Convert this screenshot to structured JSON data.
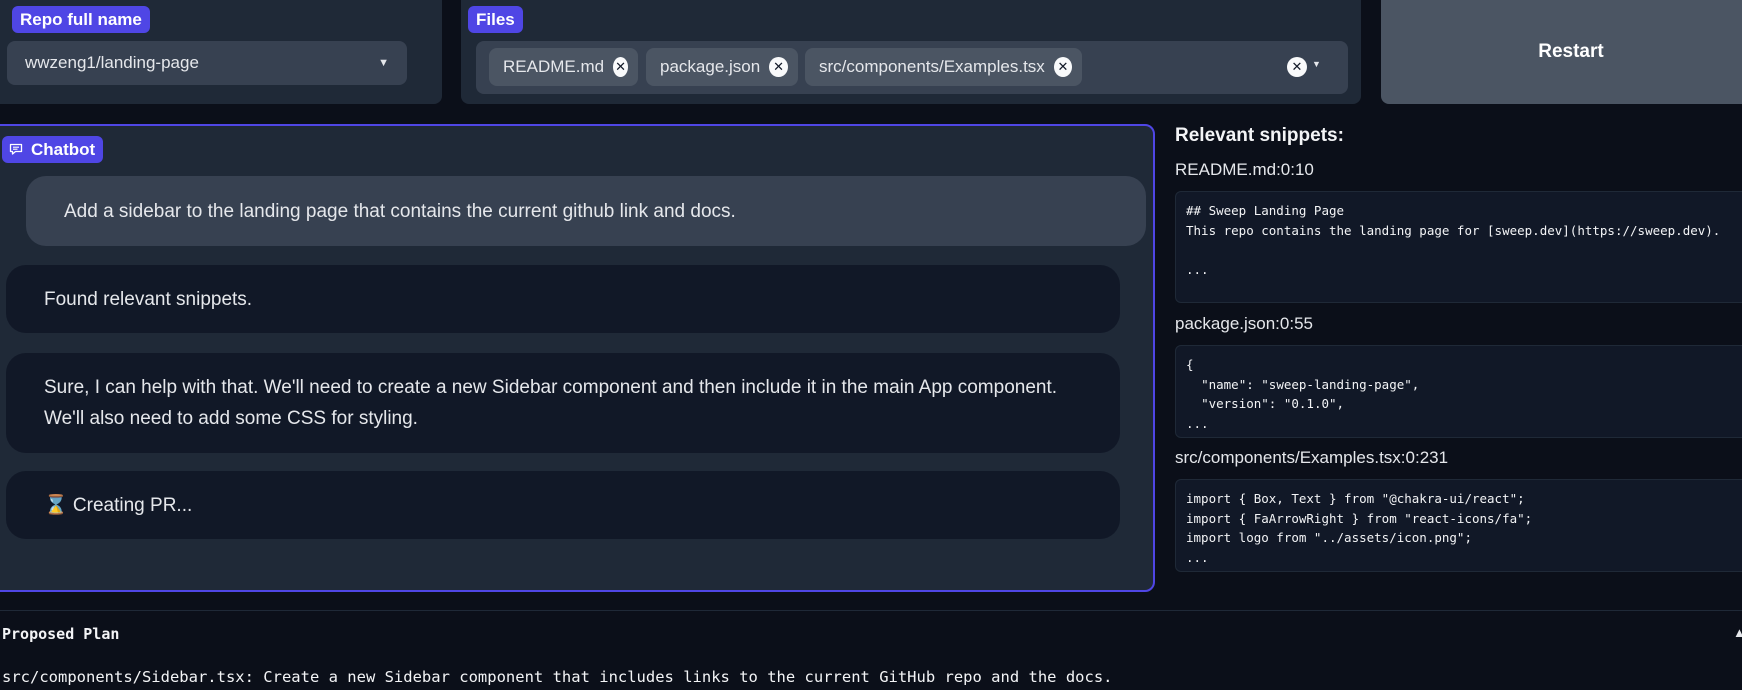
{
  "repo": {
    "label": "Repo full name",
    "value": "wwzeng1/landing-page"
  },
  "files": {
    "label": "Files",
    "selected": [
      "README.md",
      "package.json",
      "src/components/Examples.tsx"
    ]
  },
  "restart_label": "Restart",
  "chatbot": {
    "label": "Chatbot",
    "messages": [
      {
        "role": "user",
        "text": "Add a sidebar to the landing page that contains the current github link and docs."
      },
      {
        "role": "bot",
        "text": "Found relevant snippets."
      },
      {
        "role": "bot",
        "text": "Sure, I can help with that. We'll need to create a new Sidebar component and then include it in the main App component. We'll also need to add some CSS for styling."
      },
      {
        "role": "bot",
        "text": "⌛ Creating PR..."
      }
    ]
  },
  "snippets": {
    "title": "Relevant snippets:",
    "items": [
      {
        "name": "README.md:0:10",
        "code": "## Sweep Landing Page\nThis repo contains the landing page for [sweep.dev](https://sweep.dev).\n\n..."
      },
      {
        "name": "package.json:0:55",
        "code": "{\n  \"name\": \"sweep-landing-page\",\n  \"version\": \"0.1.0\",\n..."
      },
      {
        "name": "src/components/Examples.tsx:0:231",
        "code": "import { Box, Text } from \"@chakra-ui/react\";\nimport { FaArrowRight } from \"react-icons/fa\";\nimport logo from \"../assets/icon.png\";\n..."
      }
    ]
  },
  "plan": {
    "title": "Proposed Plan",
    "item": "src/components/Sidebar.tsx: Create a new Sidebar component that includes links to the current GitHub repo and the docs."
  }
}
